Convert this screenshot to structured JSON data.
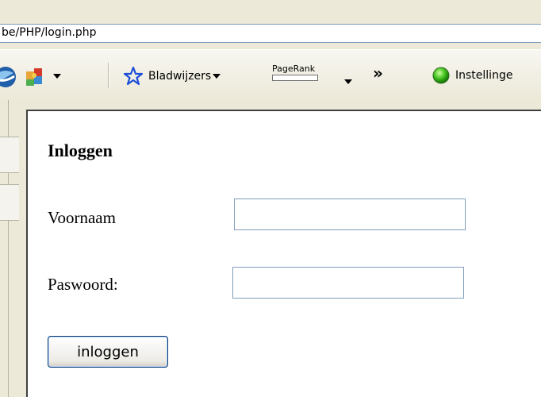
{
  "browser": {
    "address": "be/PHP/login.php"
  },
  "toolbar": {
    "bookmarks_label": "Bladwijzers",
    "pagerank_label": "PageRank",
    "more_label": "»",
    "settings_label": "Instellinge"
  },
  "page": {
    "title": "Inloggen",
    "fields": [
      {
        "label": "Voornaam",
        "value": "",
        "placeholder": ""
      },
      {
        "label": "Paswoord:",
        "value": "",
        "placeholder": ""
      }
    ],
    "submit_label": "inloggen"
  },
  "icons": [
    "browser-globe-icon",
    "puzzle-icon",
    "star-icon",
    "green-circle-icon"
  ],
  "colors": {
    "chrome": "#ece9d8",
    "input_border": "#7f9db9",
    "button_border": "#003c74"
  }
}
